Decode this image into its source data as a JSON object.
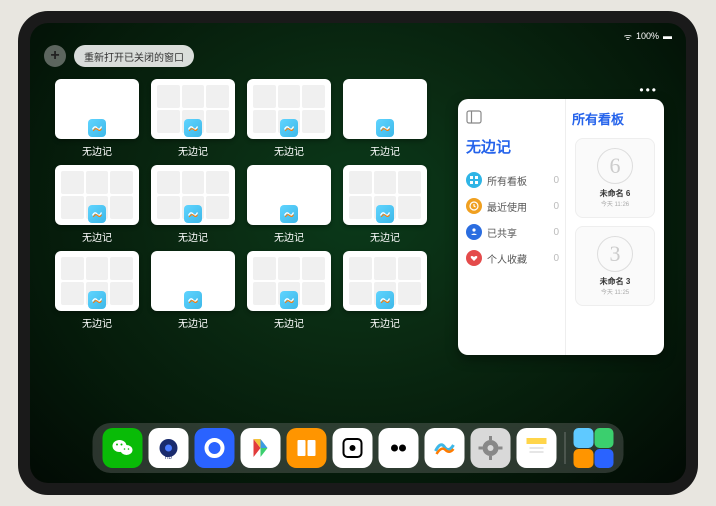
{
  "status": {
    "battery": "100%",
    "wifi": "●●●"
  },
  "topbar": {
    "plus": "+",
    "restore_label": "重新打开已关闭的窗口"
  },
  "thumbs": [
    {
      "label": "无边记",
      "variant": "blank"
    },
    {
      "label": "无边记",
      "variant": "grid"
    },
    {
      "label": "无边记",
      "variant": "grid"
    },
    {
      "label": "无边记",
      "variant": "blank"
    },
    {
      "label": "无边记",
      "variant": "grid"
    },
    {
      "label": "无边记",
      "variant": "grid"
    },
    {
      "label": "无边记",
      "variant": "blank"
    },
    {
      "label": "无边记",
      "variant": "grid"
    },
    {
      "label": "无边记",
      "variant": "grid"
    },
    {
      "label": "无边记",
      "variant": "blank"
    },
    {
      "label": "无边记",
      "variant": "grid"
    },
    {
      "label": "无边记",
      "variant": "grid"
    }
  ],
  "panel": {
    "title": "无边记",
    "right_title": "所有看板",
    "filters": [
      {
        "icon": "grid",
        "color": "#2fb5e6",
        "label": "所有看板",
        "count": 0
      },
      {
        "icon": "clock",
        "color": "#f0a020",
        "label": "最近使用",
        "count": 0
      },
      {
        "icon": "share",
        "color": "#2b6de0",
        "label": "已共享",
        "count": 0
      },
      {
        "icon": "heart",
        "color": "#e44b4b",
        "label": "个人收藏",
        "count": 0
      }
    ],
    "boards": [
      {
        "sketch": "6",
        "name": "未命名 6",
        "sub": "今天 11:26"
      },
      {
        "sketch": "3",
        "name": "未命名 3",
        "sub": "今天 11:25"
      }
    ]
  },
  "dock": {
    "apps": [
      {
        "name": "wechat",
        "bg": "#09bb07",
        "glyph": "wechat"
      },
      {
        "name": "quark-hd",
        "bg": "#ffffff",
        "glyph": "circle-blue"
      },
      {
        "name": "quark",
        "bg": "#2a63ff",
        "glyph": "circle-white"
      },
      {
        "name": "play",
        "bg": "#ffffff",
        "glyph": "play"
      },
      {
        "name": "books",
        "bg": "#ff9500",
        "glyph": "books"
      },
      {
        "name": "dice",
        "bg": "#ffffff",
        "glyph": "dice"
      },
      {
        "name": "camera-x",
        "bg": "#ffffff",
        "glyph": "two-dots"
      },
      {
        "name": "freeform",
        "bg": "#ffffff",
        "glyph": "freeform"
      },
      {
        "name": "settings",
        "bg": "#d9d9d9",
        "glyph": "gear"
      },
      {
        "name": "notes",
        "bg": "#ffffff",
        "glyph": "notes"
      }
    ]
  }
}
